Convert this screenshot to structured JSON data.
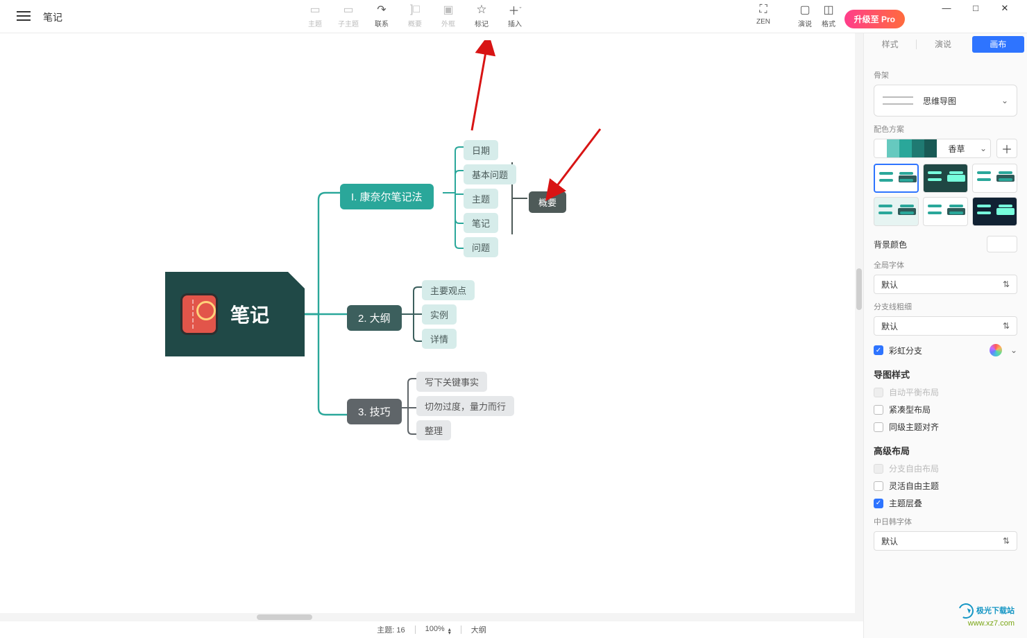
{
  "window": {
    "doc_title": "笔记",
    "minimize": "—",
    "maximize": "□",
    "close": "✕"
  },
  "toolbar": {
    "main_topic": {
      "label": "主题"
    },
    "sub_topic": {
      "label": "子主题"
    },
    "relation": {
      "label": "联系"
    },
    "summary": {
      "label": "概要"
    },
    "boundary": {
      "label": "外框"
    },
    "marker": {
      "label": "标记"
    },
    "insert": {
      "label": "插入"
    },
    "zen": {
      "label": "ZEN"
    },
    "pitch": {
      "label": "演说"
    },
    "format": {
      "label": "格式"
    },
    "pro": {
      "label": "升级至 Pro"
    }
  },
  "mindmap": {
    "root": "笔记",
    "b1": {
      "title": "I. 康奈尔笔记法",
      "leaves": [
        "日期",
        "基本问题",
        "主题",
        "笔记",
        "问题"
      ],
      "summary": "概要"
    },
    "b2": {
      "title": "2. 大纲",
      "leaves": [
        "主要观点",
        "实例",
        "详情"
      ]
    },
    "b3": {
      "title": "3. 技巧",
      "leaves": [
        "写下关键事实",
        "切勿过度，量力而行",
        "整理"
      ]
    }
  },
  "panel": {
    "tabs": {
      "style": "样式",
      "pitch": "演说",
      "canvas": "画布"
    },
    "skeleton": {
      "section": "骨架",
      "value": "思维导图"
    },
    "scheme": {
      "section": "配色方案",
      "value": "香草",
      "colors": [
        "#ffffff",
        "#66c9bf",
        "#2aa79a",
        "#1f7a72",
        "#195a55"
      ]
    },
    "bg": {
      "label": "背景颜色"
    },
    "font": {
      "section": "全局字体",
      "value": "默认"
    },
    "line": {
      "section": "分支线粗细",
      "value": "默认"
    },
    "rainbow": {
      "label": "彩虹分支"
    },
    "map_style": {
      "head": "导图样式",
      "auto_balance": "自动平衡布局",
      "compact": "紧凑型布局",
      "align_siblings": "同级主题对齐"
    },
    "advanced": {
      "head": "高级布局",
      "free_branch": "分支自由布局",
      "free_topic": "灵活自由主题",
      "overlap": "主题层叠"
    },
    "cjk": {
      "section": "中日韩字体",
      "value": "默认"
    }
  },
  "status": {
    "topic_label": "主题:",
    "topic_count": "16",
    "zoom": "100%",
    "mode": "大纲"
  },
  "watermark": {
    "cn": "极光下载站",
    "url": "www.xz7.com"
  }
}
